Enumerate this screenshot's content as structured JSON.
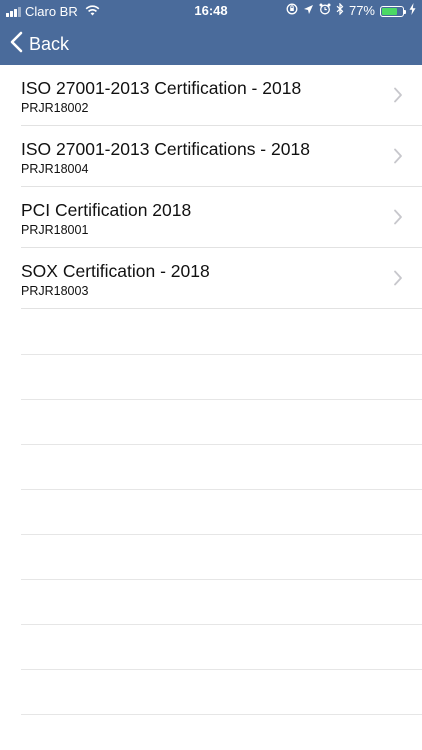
{
  "status_bar": {
    "carrier": "Claro BR",
    "time": "16:48",
    "battery_percent": "77%",
    "battery_level": 0.77,
    "signal_bars_filled": 3,
    "icons": [
      "signal-icon",
      "wifi-icon",
      "rotation-lock-icon",
      "location-icon",
      "alarm-icon",
      "bluetooth-icon",
      "battery-icon",
      "charging-icon"
    ],
    "battery_color": "#4cd964"
  },
  "nav": {
    "back_label": "Back",
    "background_color": "#4a6b9b"
  },
  "items": [
    {
      "title": "ISO 27001-2013 Certification - 2018",
      "subtitle": "PRJR18002"
    },
    {
      "title": "ISO 27001-2013 Certifications - 2018",
      "subtitle": "PRJR18004"
    },
    {
      "title": "PCI Certification 2018",
      "subtitle": "PRJR18001"
    },
    {
      "title": "SOX Certification - 2018",
      "subtitle": "PRJR18003"
    }
  ]
}
